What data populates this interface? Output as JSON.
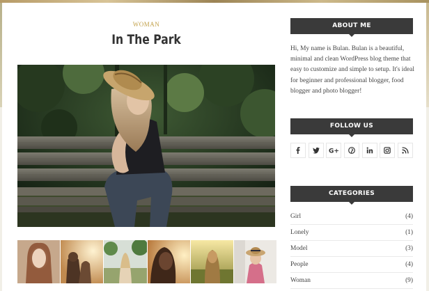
{
  "post": {
    "category": "WOMAN",
    "title": "In The Park"
  },
  "sidebar": {
    "about": {
      "title": "ABOUT ME",
      "text": "Hi, My name is Bulan. Bulan is a beautiful, minimal and clean WordPress blog theme that easy to customize and simple to setup. It's ideal for beginner and professional blogger, food blogger and photo blogger!"
    },
    "follow": {
      "title": "FOLLOW US",
      "icons": [
        "facebook-icon",
        "twitter-icon",
        "google-plus-icon",
        "pinterest-icon",
        "linkedin-icon",
        "instagram-icon",
        "rss-icon"
      ]
    },
    "categories": {
      "title": "CATEGORIES",
      "items": [
        {
          "name": "Girl",
          "count": "(4)"
        },
        {
          "name": "Lonely",
          "count": "(1)"
        },
        {
          "name": "Model",
          "count": "(3)"
        },
        {
          "name": "People",
          "count": "(4)"
        },
        {
          "name": "Woman",
          "count": "(9)"
        }
      ]
    }
  },
  "gallery": {
    "thumbnails": [
      "portrait-redhead",
      "couple-sunset",
      "girl-field",
      "woman-sunset",
      "girl-sunset-field",
      "girl-straw-hat"
    ]
  },
  "colors": {
    "accent": "#c2a14a",
    "widget_header": "#3a3a3a"
  }
}
